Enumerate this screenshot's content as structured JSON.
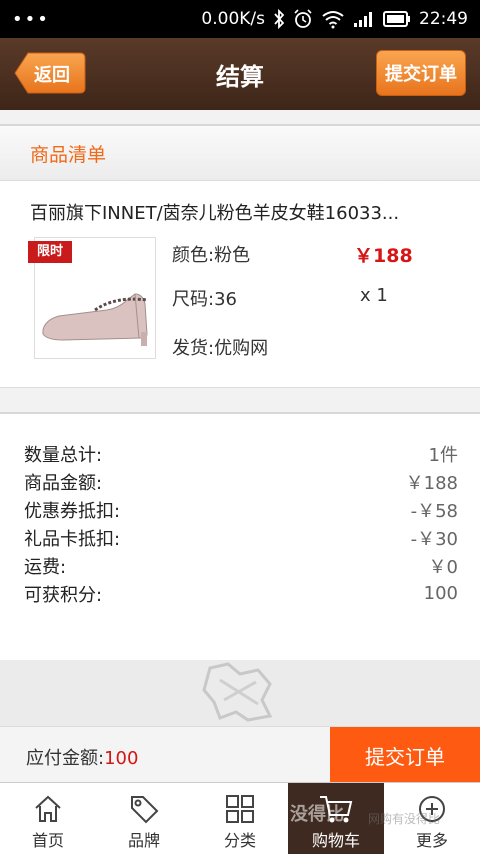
{
  "status_bar": {
    "speed": "0.00K/s",
    "time": "22:49"
  },
  "header": {
    "back_label": "返回",
    "title": "结算",
    "submit_label": "提交订单"
  },
  "list": {
    "title": "商品清单",
    "product": {
      "name": "百丽旗下INNET/茵奈儿粉色羊皮女鞋16033...",
      "tag": "限时",
      "color": "颜色:粉色",
      "size": "尺码:36",
      "shipping": "发货:优购网",
      "price": "￥188",
      "qty": "x 1"
    }
  },
  "summary": [
    {
      "label": "数量总计:",
      "value": "1件"
    },
    {
      "label": "商品金额:",
      "value": "￥188"
    },
    {
      "label": "优惠券抵扣:",
      "value": "-￥58"
    },
    {
      "label": "礼品卡抵扣:",
      "value": "-￥30"
    },
    {
      "label": "运费:",
      "value": "￥0"
    },
    {
      "label": "可获积分:",
      "value": "100"
    }
  ],
  "pay": {
    "label": "应付金额:",
    "amount": "100",
    "button": "提交订单"
  },
  "tabs": [
    {
      "label": "首页",
      "icon": "home-icon"
    },
    {
      "label": "品牌",
      "icon": "tag-icon"
    },
    {
      "label": "分类",
      "icon": "grid-icon"
    },
    {
      "label": "购物车",
      "icon": "cart-icon"
    },
    {
      "label": "更多",
      "icon": "plus-circle-icon"
    }
  ],
  "watermark": {
    "text": "没得比",
    "sub": "网购有没得比"
  },
  "colors": {
    "accent": "#f06a1a",
    "price": "#d61515",
    "header_bg": "#4a2f20",
    "pay_button": "#ff5a12"
  }
}
